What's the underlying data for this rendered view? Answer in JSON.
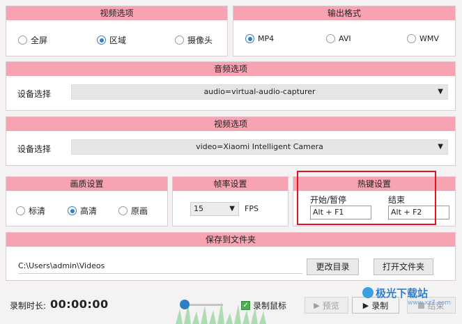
{
  "video_mode": {
    "title": "视频选项",
    "options": [
      "全屏",
      "区域",
      "摄像头"
    ],
    "selected": "区域"
  },
  "output_format": {
    "title": "输出格式",
    "options": [
      "MP4",
      "AVI",
      "WMV"
    ],
    "selected": "MP4"
  },
  "audio": {
    "title": "音频选项",
    "device_label": "设备选择",
    "device_value": "audio=virtual-audio-capturer"
  },
  "video_device": {
    "title": "视频选项",
    "device_label": "设备选择",
    "device_value": "video=Xiaomi Intelligent Camera"
  },
  "quality": {
    "title": "画质设置",
    "options": [
      "标清",
      "高清",
      "原画"
    ],
    "selected": "高清"
  },
  "framerate": {
    "title": "帧率设置",
    "value": "15",
    "unit": "FPS"
  },
  "hotkeys": {
    "title": "热键设置",
    "start_pause_label": "开始/暂停",
    "start_pause_value": "Alt + F1",
    "end_label": "结束",
    "end_value": "Alt + F2"
  },
  "save_folder": {
    "title": "保存到文件夹",
    "path": "C:\\Users\\admin\\Videos",
    "change_button": "更改目录",
    "open_button": "打开文件夹"
  },
  "bottom": {
    "duration_label": "录制时长:",
    "duration_value": "00:00:00",
    "record_mouse_label": "录制鼠标",
    "preview_label": "预览",
    "record_label": "录制",
    "stop_label": "结束",
    "watermark": "极光下载站",
    "watermark_url": "www.xz7.com"
  },
  "colors": {
    "header_pink": "#f7a3b1",
    "accent_blue": "#2f7dc4",
    "highlight_red": "#e0141e"
  }
}
